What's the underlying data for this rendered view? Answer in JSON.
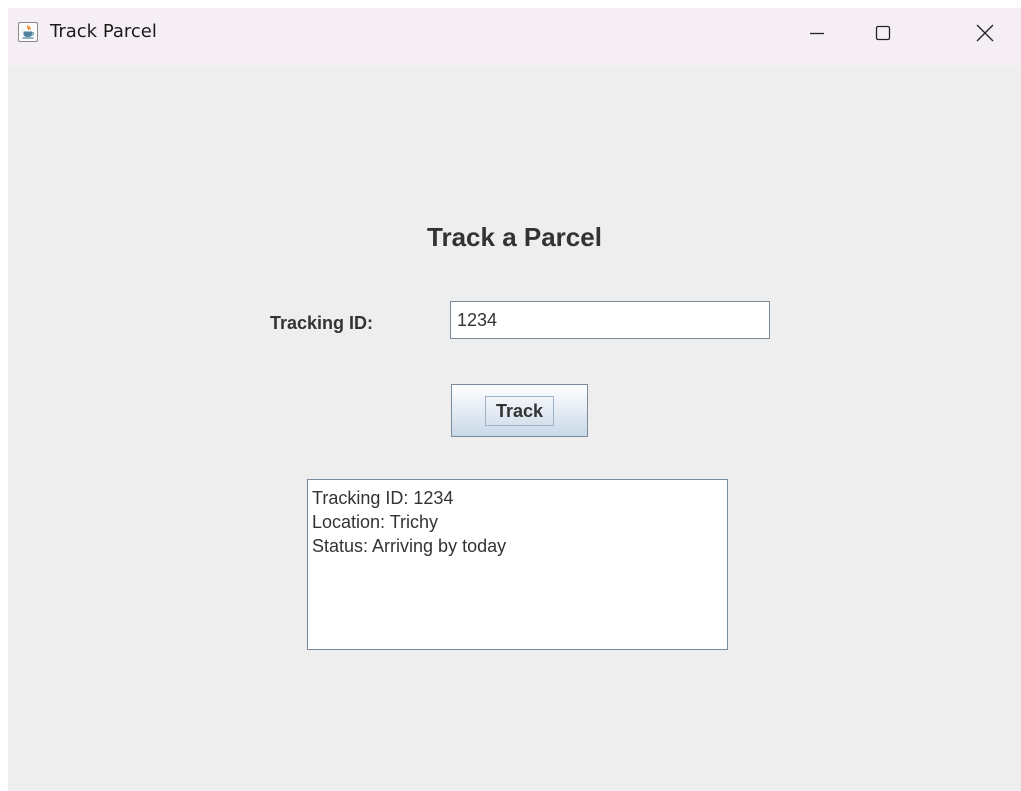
{
  "window": {
    "title": "Track Parcel",
    "app_icon": "java-coffee-cup-icon",
    "controls": [
      "minimize-icon",
      "maximize-icon",
      "close-icon"
    ]
  },
  "form": {
    "heading": "Track a Parcel",
    "tracking_label": "Tracking ID:",
    "tracking_value": "1234",
    "track_button_label": "Track"
  },
  "result": {
    "lines": [
      "Tracking ID: 1234",
      "Location: Trichy",
      "Status: Arriving by today"
    ]
  },
  "colors": {
    "window_background": "#eeeeee",
    "titlebar_background": "#f6eef5",
    "text": "#333333",
    "field_border": "#7a8a99"
  }
}
